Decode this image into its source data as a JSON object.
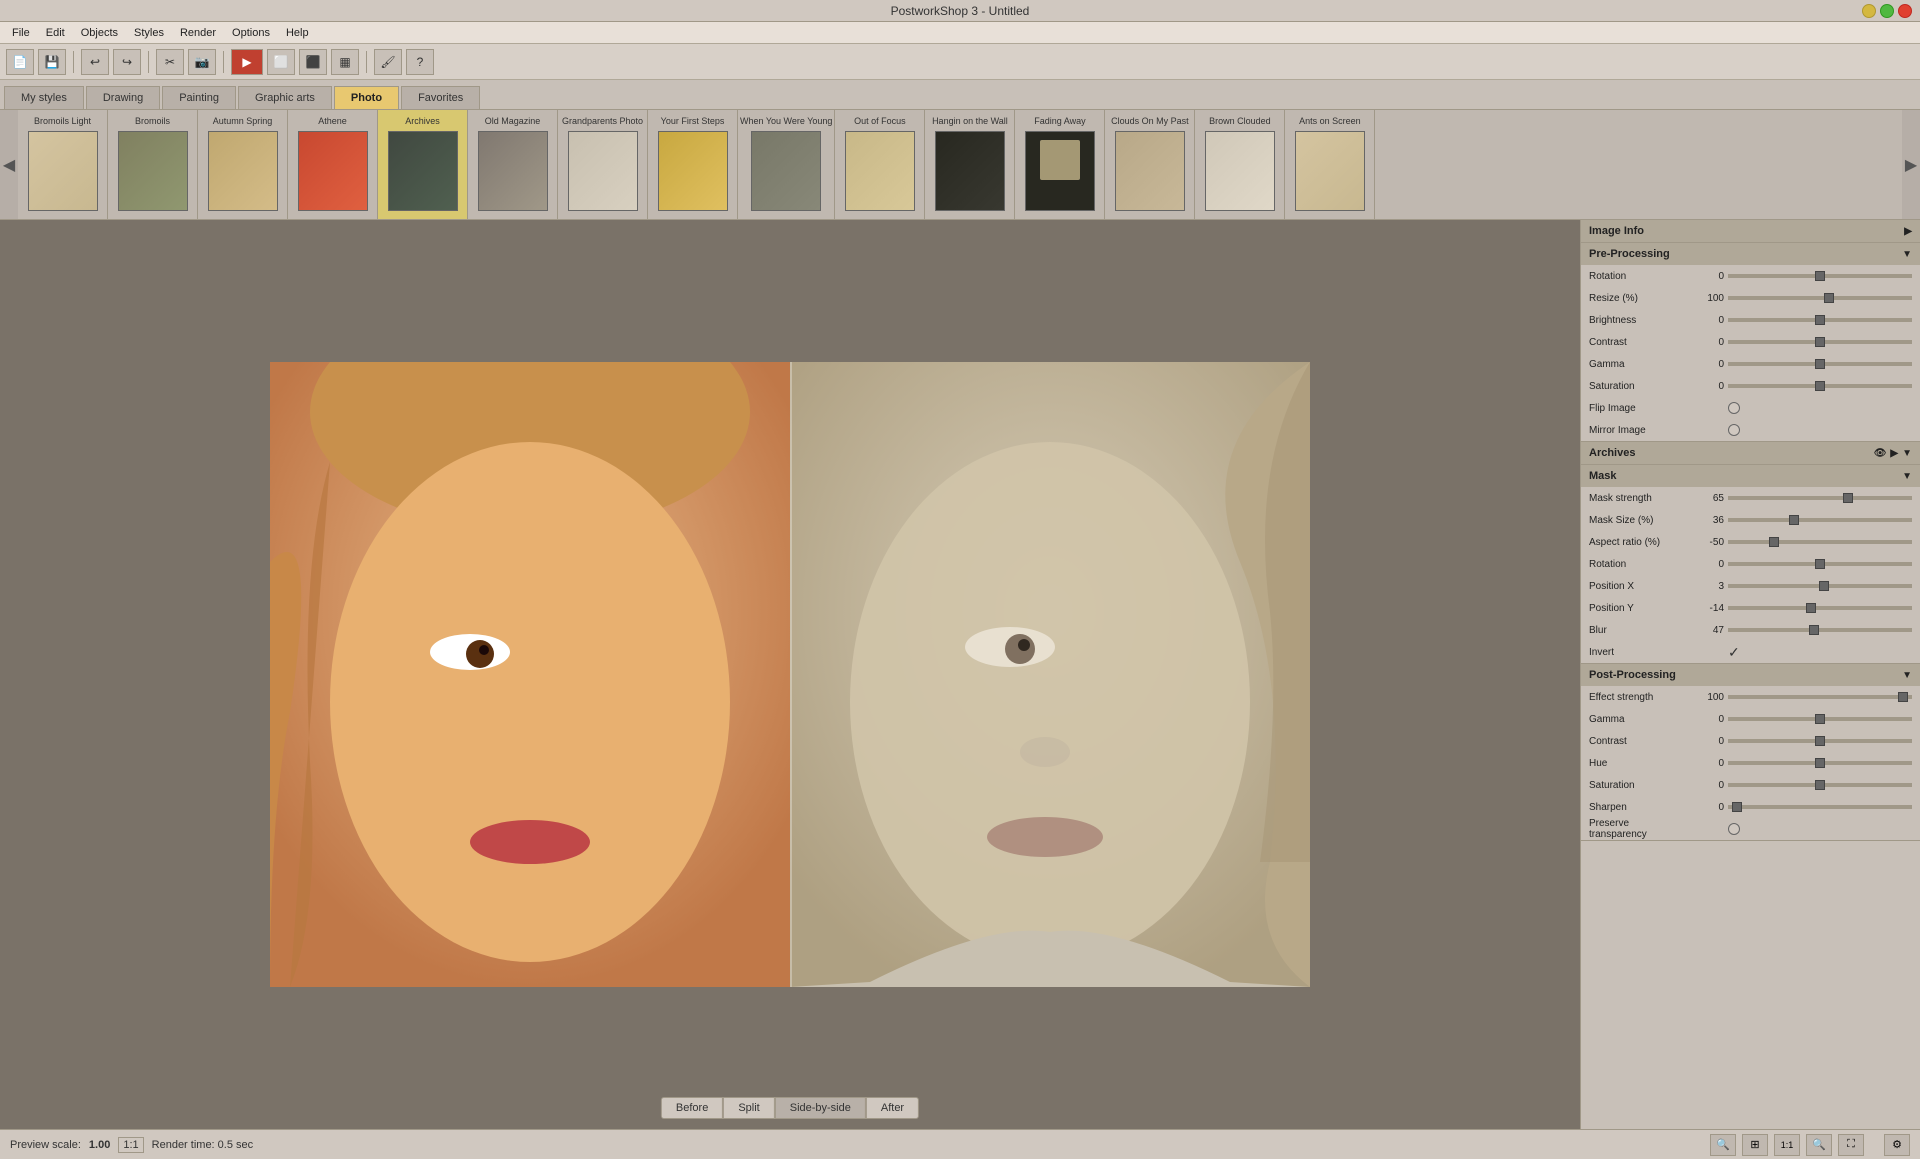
{
  "app": {
    "title": "PostworkShop 3 - Untitled",
    "menu_items": [
      "File",
      "Edit",
      "Objects",
      "Styles",
      "Render",
      "Options",
      "Help"
    ]
  },
  "tabs": [
    {
      "label": "My styles",
      "active": false
    },
    {
      "label": "Drawing",
      "active": false
    },
    {
      "label": "Painting",
      "active": false
    },
    {
      "label": "Graphic arts",
      "active": false
    },
    {
      "label": "Photo",
      "active": false
    },
    {
      "label": "Favorites",
      "active": false
    }
  ],
  "active_tab": "Photo",
  "thumbnails": [
    {
      "label": "Bromoils Light",
      "color": "t1",
      "selected": false
    },
    {
      "label": "Bromoils",
      "color": "t2",
      "selected": false
    },
    {
      "label": "Autumn Spring",
      "color": "t3",
      "selected": false
    },
    {
      "label": "Athene",
      "color": "t4",
      "selected": false
    },
    {
      "label": "Archives",
      "color": "t5",
      "selected": true
    },
    {
      "label": "Old Magazine",
      "color": "t6",
      "selected": false
    },
    {
      "label": "Grandparents Photo",
      "color": "t7",
      "selected": false
    },
    {
      "label": "Your First Steps",
      "color": "t8",
      "selected": false
    },
    {
      "label": "When You Were Young",
      "color": "t9",
      "selected": false
    },
    {
      "label": "Out of Focus",
      "color": "t10",
      "selected": false
    },
    {
      "label": "Hangin on the Wall",
      "color": "t11",
      "selected": false
    },
    {
      "label": "Fading Away",
      "color": "t12",
      "selected": false
    },
    {
      "label": "Clouds On My Past",
      "color": "t13",
      "selected": false
    },
    {
      "label": "Brown Clouded",
      "color": "t14",
      "selected": false
    },
    {
      "label": "Ants on Screen",
      "color": "t1",
      "selected": false
    }
  ],
  "panel": {
    "image_info": {
      "header": "Image Info"
    },
    "pre_processing": {
      "header": "Pre-Processing",
      "fields": [
        {
          "label": "Rotation",
          "value": "0",
          "thumb_pct": 50
        },
        {
          "label": "Resize (%)",
          "value": "100",
          "thumb_pct": 55
        },
        {
          "label": "Brightness",
          "value": "0",
          "thumb_pct": 50
        },
        {
          "label": "Contrast",
          "value": "0",
          "thumb_pct": 50
        },
        {
          "label": "Gamma",
          "value": "0",
          "thumb_pct": 50
        },
        {
          "label": "Saturation",
          "value": "0",
          "thumb_pct": 50
        },
        {
          "label": "Flip Image",
          "value": "",
          "type": "checkbox",
          "checked": false
        },
        {
          "label": "Mirror Image",
          "value": "",
          "type": "checkbox",
          "checked": false
        }
      ]
    },
    "archives": {
      "header": "Archives"
    },
    "mask": {
      "header": "Mask",
      "fields": [
        {
          "label": "Mask strength",
          "value": "65",
          "thumb_pct": 65
        },
        {
          "label": "Mask Size (%)",
          "value": "36",
          "thumb_pct": 36
        },
        {
          "label": "Aspect ratio (%)",
          "value": "-50",
          "thumb_pct": 25
        },
        {
          "label": "Rotation",
          "value": "0",
          "thumb_pct": 50
        },
        {
          "label": "Position X",
          "value": "3",
          "thumb_pct": 52
        },
        {
          "label": "Position Y",
          "value": "-14",
          "thumb_pct": 45
        },
        {
          "label": "Blur",
          "value": "47",
          "thumb_pct": 47
        },
        {
          "label": "Invert",
          "value": "",
          "type": "checkmark",
          "checked": true
        }
      ]
    },
    "post_processing": {
      "header": "Post-Processing",
      "fields": [
        {
          "label": "Effect strength",
          "value": "100",
          "thumb_pct": 95
        },
        {
          "label": "Gamma",
          "value": "0",
          "thumb_pct": 50
        },
        {
          "label": "Contrast",
          "value": "0",
          "thumb_pct": 50
        },
        {
          "label": "Hue",
          "value": "0",
          "thumb_pct": 50
        },
        {
          "label": "Saturation",
          "value": "0",
          "thumb_pct": 50
        },
        {
          "label": "Sharpen",
          "value": "0",
          "thumb_pct": 5
        },
        {
          "label": "Preserve transparency",
          "value": "",
          "type": "checkbox",
          "checked": false
        }
      ]
    }
  },
  "preview": {
    "scale_label": "Preview scale:",
    "scale_value": "1.00",
    "scale_ratio": "1:1",
    "render_label": "Render time:",
    "render_value": "0.5 sec"
  },
  "preview_buttons": [
    "Before",
    "Split",
    "Side-by-side",
    "After"
  ],
  "active_preview": "Split"
}
